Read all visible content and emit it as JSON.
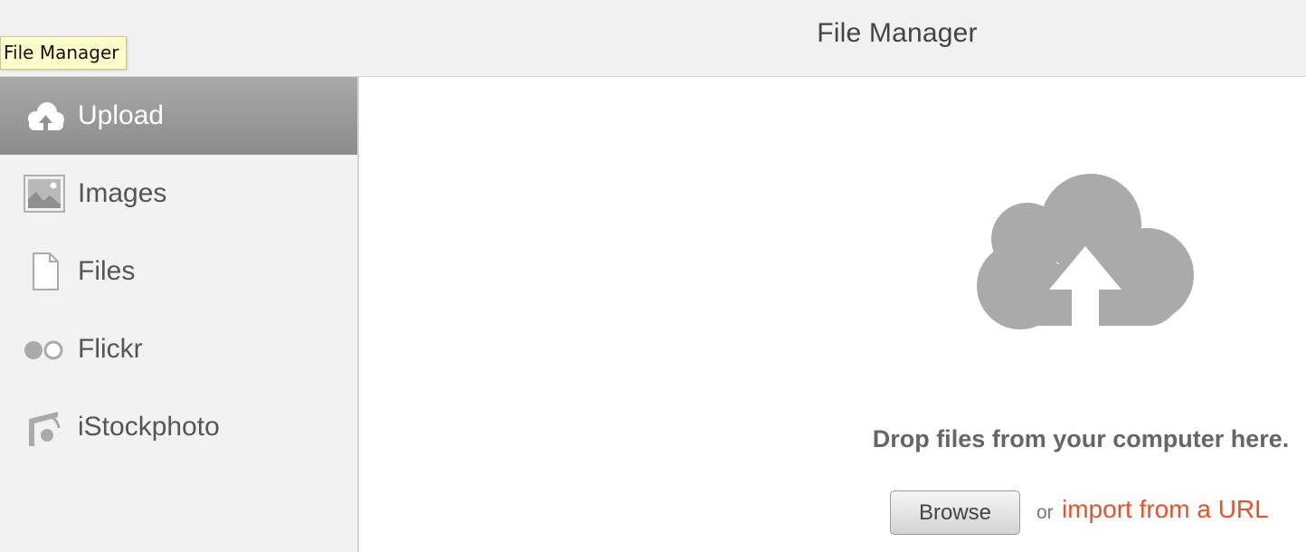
{
  "header": {
    "title": "File Manager"
  },
  "tooltip": {
    "text": "File Manager"
  },
  "sidebar": {
    "items": [
      {
        "label": "Upload",
        "icon": "cloud-upload-icon",
        "active": true
      },
      {
        "label": "Images",
        "icon": "image-icon",
        "active": false
      },
      {
        "label": "Files",
        "icon": "file-icon",
        "active": false
      },
      {
        "label": "Flickr",
        "icon": "flickr-icon",
        "active": false
      },
      {
        "label": "iStockphoto",
        "icon": "istockphoto-icon",
        "active": false
      }
    ]
  },
  "upload": {
    "icon": "cloud-upload-icon",
    "drop_text": "Drop files from your computer here.",
    "browse_label": "Browse",
    "or_text": "or",
    "import_link": "import from a URL"
  },
  "colors": {
    "link": "#e5522b",
    "active_nav_top": "#a9a9a9",
    "active_nav_bottom": "#8c8c8c",
    "sidebar_bg": "#f2f2f2",
    "icon_gray": "#aaaaaa",
    "tooltip_bg": "#fefec8"
  }
}
